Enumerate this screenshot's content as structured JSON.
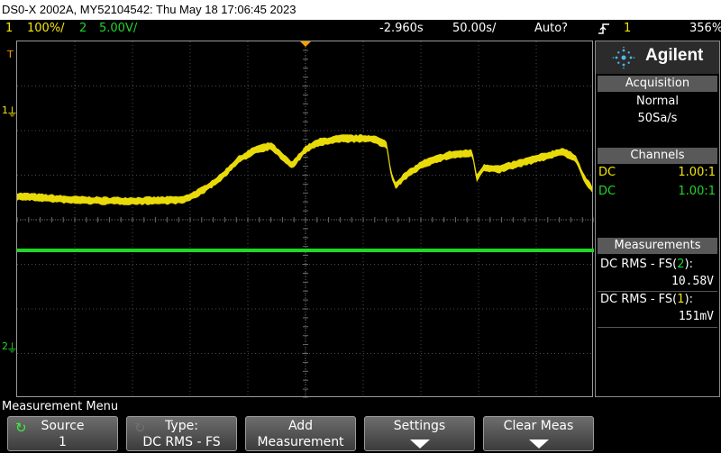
{
  "title_bar": {
    "text": "DS0-X 2002A, MY52104542: Thu May 18 17:06:45 2023"
  },
  "status_bar": {
    "ch1_number": "1",
    "ch1_scale": "100%/",
    "ch2_number": "2",
    "ch2_scale": "5.00V/",
    "time_delay": "-2.960s",
    "time_scale": "50.00s/",
    "trigger_mode": "Auto?",
    "trigger_icon": "rising-edge-icon",
    "trigger_source": "1",
    "trigger_level": "356%"
  },
  "screen": {
    "trigger_marker": "T",
    "ch1_marker": "1",
    "ch2_marker": "2",
    "colors": {
      "ch1": "#f5e60a",
      "ch2": "#22d52a",
      "grid": "#4a4a4a"
    }
  },
  "side_panel": {
    "brand": "Agilent",
    "acquisition": {
      "header": "Acquisition",
      "mode": "Normal",
      "rate": "50Sa/s"
    },
    "channels": {
      "header": "Channels",
      "rows": [
        {
          "coupling": "DC",
          "probe": "1.00:1",
          "color": "#f5e60a"
        },
        {
          "coupling": "DC",
          "probe": "1.00:1",
          "color": "#22d52a"
        }
      ]
    },
    "measurements": {
      "header": "Measurements",
      "items": [
        {
          "label_prefix": "DC RMS - FS(",
          "label_channel": "2",
          "label_suffix": "):",
          "value": "10.58V",
          "channel_color": "#22d52a"
        },
        {
          "label_prefix": "DC RMS - FS(",
          "label_channel": "1",
          "label_suffix": "):",
          "value": "151mV",
          "channel_color": "#f5e60a"
        }
      ]
    }
  },
  "menu": {
    "title": "Measurement Menu",
    "softkeys": [
      {
        "line1": "Source",
        "line2": "1"
      },
      {
        "line1": "Type:",
        "line2": "DC RMS - FS"
      },
      {
        "line1": "Add",
        "line2": "Measurement"
      },
      {
        "line1": "Settings",
        "line2": ""
      },
      {
        "line1": "Clear Meas",
        "line2": ""
      }
    ]
  }
}
